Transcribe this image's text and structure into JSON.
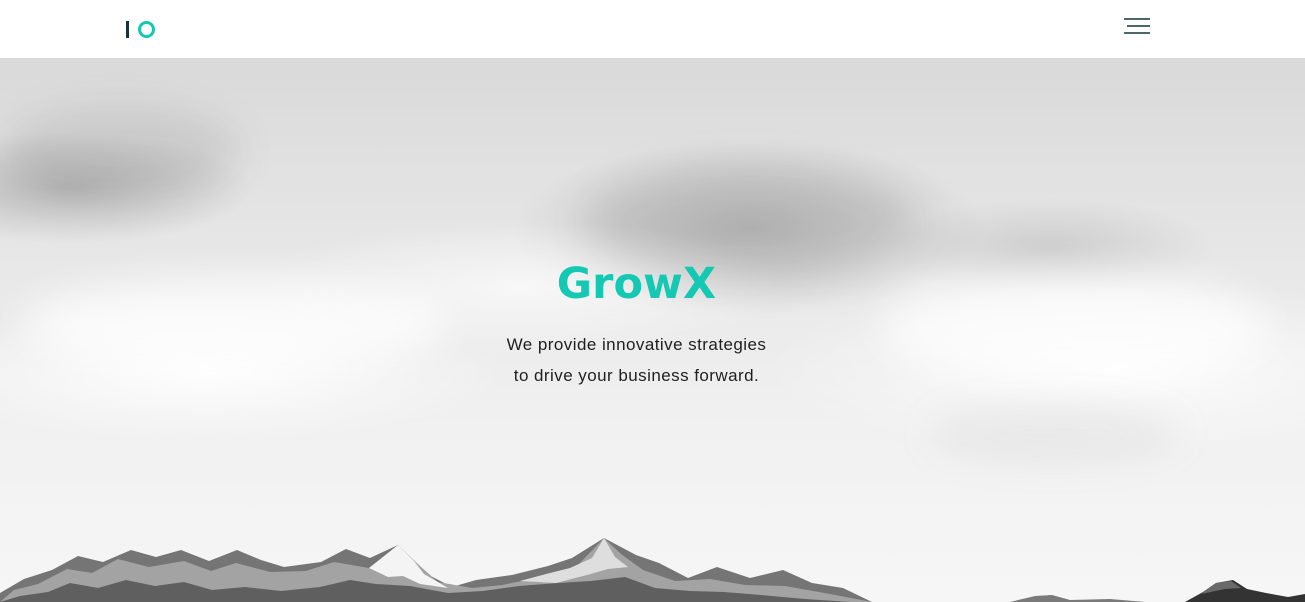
{
  "header": {
    "logo": "IO",
    "menu_icon": "hamburger-menu-icon"
  },
  "hero": {
    "title": "GrowX",
    "description_line_1": "We provide innovative strategies",
    "description_line_2": "to drive your business forward.",
    "background": "grayscale-cloudy-mountain-landscape"
  },
  "colors": {
    "accent": "#14c8b4",
    "text": "#1f1f1f",
    "navbar_background": "#ffffff"
  }
}
